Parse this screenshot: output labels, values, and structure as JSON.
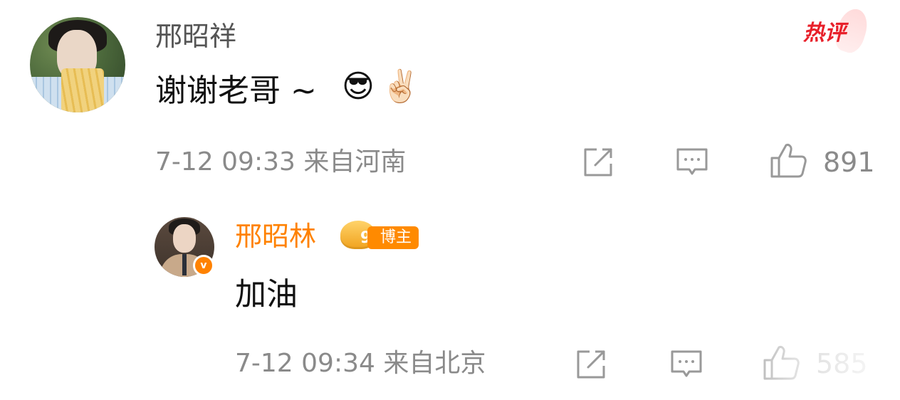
{
  "hot_badge": {
    "label": "热评",
    "color": "#e8202a"
  },
  "comments": [
    {
      "username": "邢昭祥",
      "text": "谢谢老哥 ~",
      "emojis": [
        "😎",
        "✌🏻"
      ],
      "meta": "7-12 09:33  来自河南",
      "like_count": "891"
    },
    {
      "username": "邢昭林",
      "verified_mark": "v",
      "badge_number": "9",
      "badge_label": "博主",
      "text": "加油",
      "meta": "7-12 09:34  来自北京",
      "like_count": "585"
    }
  ],
  "icons": {
    "share": "share-icon",
    "comment": "comment-icon",
    "like": "like-icon"
  },
  "colors": {
    "accent": "#ff8200",
    "meta_gray": "#8a8a8a",
    "icon_gray": "#999999"
  }
}
